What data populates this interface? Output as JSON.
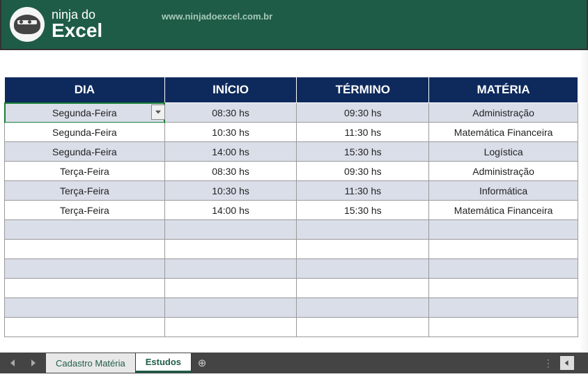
{
  "header": {
    "brand_line1": "ninja do",
    "brand_line2": "Excel",
    "site_url": "www.ninjadoexcel.com.br"
  },
  "table": {
    "headers": {
      "dia": "DIA",
      "inicio": "INÍCIO",
      "termino": "TÉRMINO",
      "materia": "MATÉRIA"
    },
    "rows": [
      {
        "dia": "Segunda-Feira",
        "inicio": "08:30 hs",
        "termino": "09:30 hs",
        "materia": "Administração"
      },
      {
        "dia": "Segunda-Feira",
        "inicio": "10:30 hs",
        "termino": "11:30 hs",
        "materia": "Matemática Financeira"
      },
      {
        "dia": "Segunda-Feira",
        "inicio": "14:00 hs",
        "termino": "15:30 hs",
        "materia": "Logística"
      },
      {
        "dia": "Terça-Feira",
        "inicio": "08:30 hs",
        "termino": "09:30 hs",
        "materia": "Administração"
      },
      {
        "dia": "Terça-Feira",
        "inicio": "10:30 hs",
        "termino": "11:30 hs",
        "materia": "Informática"
      },
      {
        "dia": "Terça-Feira",
        "inicio": "14:00 hs",
        "termino": "15:30 hs",
        "materia": "Matemática Financeira"
      },
      {
        "dia": "",
        "inicio": "",
        "termino": "",
        "materia": ""
      },
      {
        "dia": "",
        "inicio": "",
        "termino": "",
        "materia": ""
      },
      {
        "dia": "",
        "inicio": "",
        "termino": "",
        "materia": ""
      },
      {
        "dia": "",
        "inicio": "",
        "termino": "",
        "materia": ""
      },
      {
        "dia": "",
        "inicio": "",
        "termino": "",
        "materia": ""
      },
      {
        "dia": "",
        "inicio": "",
        "termino": "",
        "materia": ""
      }
    ],
    "selected_row": 0,
    "selected_col": "dia"
  },
  "sheets": {
    "tabs": [
      {
        "label": "Cadastro Matéria",
        "active": false
      },
      {
        "label": "Estudos",
        "active": true
      }
    ]
  }
}
